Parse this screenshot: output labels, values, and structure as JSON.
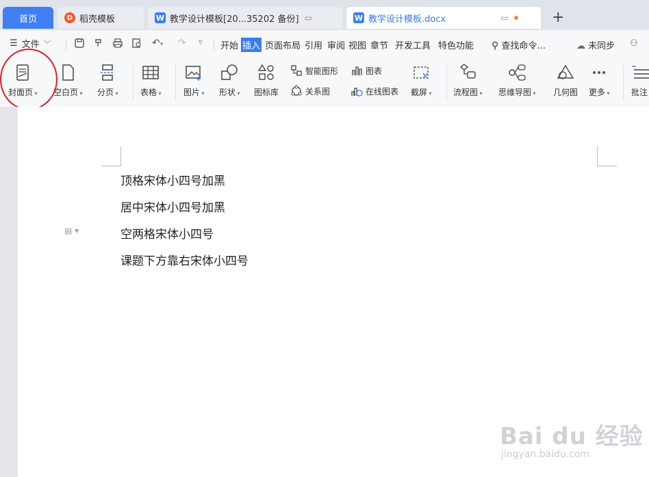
{
  "tabs": {
    "home": "首页",
    "template": "稻壳模板",
    "doc1": "教学设计模板[20...35202 备份]",
    "doc2": "教学设计模板.docx",
    "new_tab": "+"
  },
  "menubar": {
    "file": "文件",
    "tabs": [
      "开始",
      "插入",
      "页面布局",
      "引用",
      "审阅",
      "视图",
      "章节",
      "开发工具",
      "特色功能"
    ],
    "active_tab": "插入",
    "search": "查找命令...",
    "sync": "未同步"
  },
  "ribbon": {
    "cover": "封面页",
    "blank": "空白页",
    "pagebreak": "分页",
    "table": "表格",
    "picture": "图片",
    "shape": "形状",
    "iconlib": "图标库",
    "smartart": "智能图形",
    "relation": "关系图",
    "chart": "图表",
    "online_chart": "在线图表",
    "screenshot": "截屏",
    "flowchart": "流程图",
    "mindmap": "思维导图",
    "geometry": "几何图",
    "more": "更多",
    "comment": "批注"
  },
  "document": {
    "lines": [
      "顶格宋体小四号加黑",
      "居中宋体小四号加黑",
      "空两格宋体小四号",
      "课题下方靠右宋体小四号"
    ]
  },
  "watermark": {
    "brand": "Bai du 经验",
    "url": "jingyan.baidu.com"
  },
  "colors": {
    "accent": "#3b7cf1",
    "annotation_circle": "#e02020"
  }
}
